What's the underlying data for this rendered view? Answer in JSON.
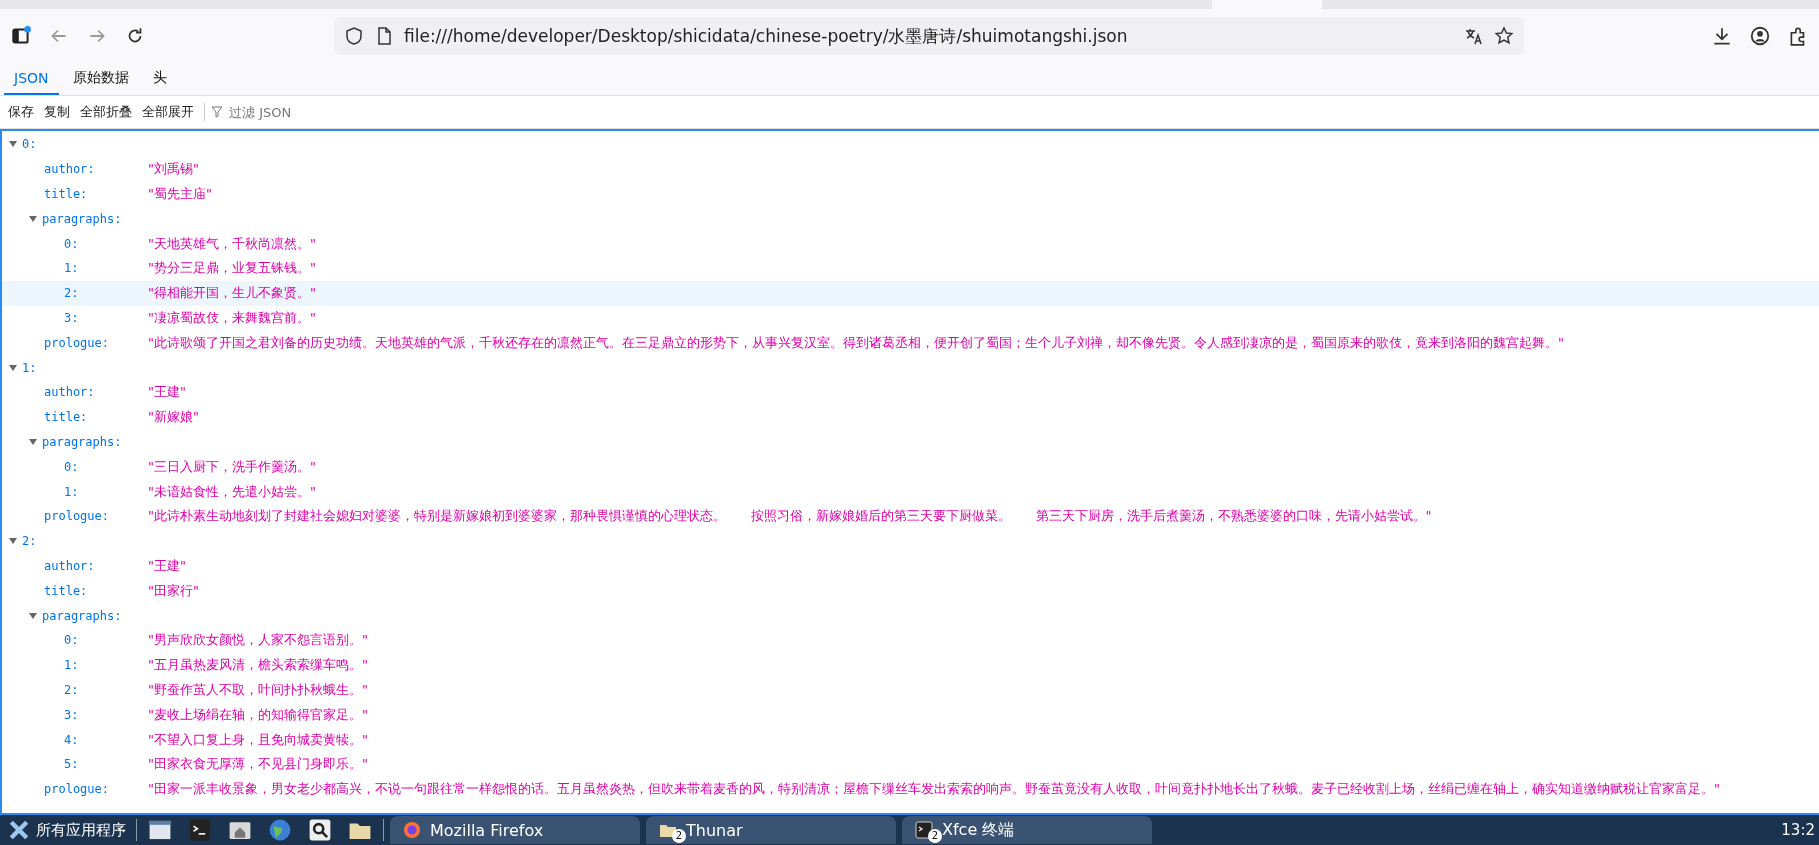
{
  "browser": {
    "url": "file:///home/developer/Desktop/shicidata/chinese-poetry/水墨唐诗/shuimotangshi.json"
  },
  "viewer": {
    "tabs": [
      {
        "label": "JSON",
        "selected": true
      },
      {
        "label": "原始数据",
        "selected": false
      },
      {
        "label": "头",
        "selected": false
      }
    ],
    "toolbar": {
      "buttons": [
        "保存",
        "复制",
        "全部折叠",
        "全部展开"
      ],
      "filter": {
        "placeholder": "过滤 JSON"
      }
    },
    "items": [
      {
        "key": "0:",
        "expanded": true,
        "fields": [
          {
            "kind": "string",
            "key": "author:",
            "value": "\"刘禹锡\""
          },
          {
            "kind": "string",
            "key": "title:",
            "value": "\"蜀先主庙\""
          },
          {
            "kind": "array",
            "key": "paragraphs:",
            "expanded": true,
            "children": [
              {
                "key": "0:",
                "value": "\"天地英雄气，千秋尚凛然。\"",
                "hovered": false
              },
              {
                "key": "1:",
                "value": "\"势分三足鼎，业复五铢钱。\"",
                "hovered": false
              },
              {
                "key": "2:",
                "value": "\"得相能开国，生儿不象贤。\"",
                "hovered": true
              },
              {
                "key": "3:",
                "value": "\"凄凉蜀故伎，来舞魏宫前。\"",
                "hovered": false
              }
            ]
          },
          {
            "kind": "string",
            "key": "prologue:",
            "value": "\"此诗歌颂了开国之君刘备的历史功绩。天地英雄的气派，千秋还存在的凛然正气。在三足鼎立的形势下，从事兴复汉室。得到诸葛丞相，便开创了蜀国；生个儿子刘禅，却不像先贤。令人感到凄凉的是，蜀国原来的歌伎，竟来到洛阳的魏宫起舞。\""
          }
        ]
      },
      {
        "key": "1:",
        "expanded": true,
        "fields": [
          {
            "kind": "string",
            "key": "author:",
            "value": "\"王建\""
          },
          {
            "kind": "string",
            "key": "title:",
            "value": "\"新嫁娘\""
          },
          {
            "kind": "array",
            "key": "paragraphs:",
            "expanded": true,
            "children": [
              {
                "key": "0:",
                "value": "\"三日入厨下，洗手作羹汤。\"",
                "hovered": false
              },
              {
                "key": "1:",
                "value": "\"未谙姑食性，先遣小姑尝。\"",
                "hovered": false
              }
            ]
          },
          {
            "kind": "string",
            "key": "prologue:",
            "value": "\"此诗朴素生动地刻划了封建社会媳妇对婆婆，特别是新嫁娘初到婆婆家，那种畏惧谨慎的心理状态。      按照习俗，新嫁娘婚后的第三天要下厨做菜。      第三天下厨房，洗手后煮羹汤，不熟悉婆婆的口味，先请小姑尝试。\""
          }
        ]
      },
      {
        "key": "2:",
        "expanded": true,
        "fields": [
          {
            "kind": "string",
            "key": "author:",
            "value": "\"王建\""
          },
          {
            "kind": "string",
            "key": "title:",
            "value": "\"田家行\""
          },
          {
            "kind": "array",
            "key": "paragraphs:",
            "expanded": true,
            "children": [
              {
                "key": "0:",
                "value": "\"男声欣欣女颜悦，人家不怨言语别。\"",
                "hovered": false
              },
              {
                "key": "1:",
                "value": "\"五月虽热麦风清，檐头索索缫车鸣。\"",
                "hovered": false
              },
              {
                "key": "2:",
                "value": "\"野蚕作茧人不取，叶间扑扑秋蛾生。\"",
                "hovered": false
              },
              {
                "key": "3:",
                "value": "\"麦收上场绢在轴，的知输得官家足。\"",
                "hovered": false
              },
              {
                "key": "4:",
                "value": "\"不望入口复上身，且免向城卖黄犊。\"",
                "hovered": false
              },
              {
                "key": "5:",
                "value": "\"田家衣食无厚薄，不见县门身即乐。\"",
                "hovered": false
              }
            ]
          },
          {
            "kind": "string",
            "key": "prologue:",
            "value": "\"田家一派丰收景象，男女老少都高兴，不说一句跟往常一样怨恨的话。五月虽然炎热，但吹来带着麦香的风，特别清凉；屋檐下缫丝车发出索索的响声。野蚕茧竟没有人收取，叶间竟扑扑地长出了秋蛾。麦子已经收割上场，丝绢已缠在轴上，确实知道缴纳赋税让官家富足。\""
          }
        ]
      }
    ]
  },
  "taskbar": {
    "menu": "所有应用程序",
    "windows": [
      {
        "title": "Mozilla Firefox",
        "kind": "firefox"
      },
      {
        "title": "Thunar",
        "kind": "folder",
        "count": "2"
      },
      {
        "title": "Xfce 终端",
        "kind": "terminal",
        "count": "2"
      }
    ],
    "clock": "13:2"
  }
}
